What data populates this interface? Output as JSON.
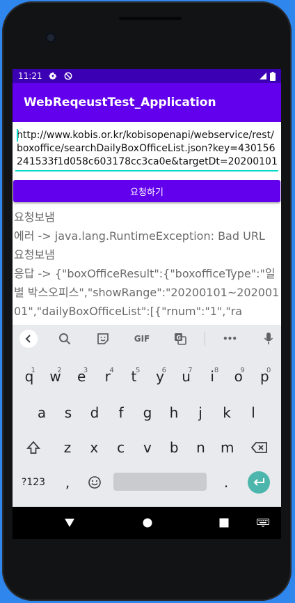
{
  "status_bar": {
    "time": "11:21"
  },
  "app_bar": {
    "title": "WebReqeustTest_Application"
  },
  "url_input": {
    "value": "http://www.kobis.or.kr/kobisopenapi/webservice/rest/boxoffice/searchDailyBoxOfficeList.json?key=430156241533f1d058c603178cc3ca0e&targetDt=20200101"
  },
  "request_button": {
    "label": "요청하기"
  },
  "log_lines": [
    "요청보냄",
    "에러 -> java.lang.RuntimeException: Bad URL",
    "요청보냄",
    "응답 -> {\"boxOfficeResult\":{\"boxofficeType\":\"일별 박스오피스\",\"showRange\":\"20200101~20200101\",\"dailyBoxOfficeList\":[{\"rnum\":\"1\",\"ra"
  ],
  "keyboard": {
    "toolbar": {
      "gif_label": "GIF",
      "more_label": "•••"
    },
    "row1": [
      {
        "label": "q",
        "hint": "1"
      },
      {
        "label": "w",
        "hint": "2"
      },
      {
        "label": "e",
        "hint": "3"
      },
      {
        "label": "r",
        "hint": "4"
      },
      {
        "label": "t",
        "hint": "5"
      },
      {
        "label": "y",
        "hint": "6"
      },
      {
        "label": "u",
        "hint": "7"
      },
      {
        "label": "i",
        "hint": "8"
      },
      {
        "label": "o",
        "hint": "9"
      },
      {
        "label": "p",
        "hint": "0"
      }
    ],
    "row2": [
      "a",
      "s",
      "d",
      "f",
      "g",
      "h",
      "j",
      "k",
      "l"
    ],
    "row3": [
      "z",
      "x",
      "c",
      "v",
      "b",
      "n",
      "m"
    ],
    "symbols_label": "?123",
    "comma_label": ",",
    "period_label": ".",
    "accent_color": "#4db6ac"
  },
  "colors": {
    "primary": "#6200ee",
    "status": "#3c00b4",
    "accent": "#03dac5"
  }
}
